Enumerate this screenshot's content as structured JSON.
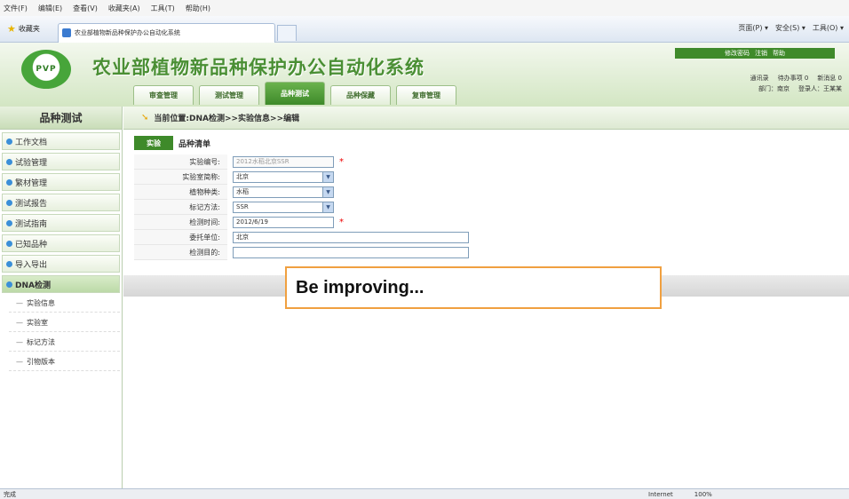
{
  "browser": {
    "menu": [
      "文件(F)",
      "编辑(E)",
      "查看(V)",
      "收藏夹(A)",
      "工具(T)",
      "帮助(H)"
    ],
    "favorites_label": "收藏夹",
    "tab_title": "农业部植物新品种保护办公自动化系统",
    "tools": [
      "页面(P) ▾",
      "安全(S) ▾",
      "工具(O) ▾"
    ],
    "status_left": "完成",
    "status_zone": "Internet",
    "status_zoom": "100%"
  },
  "app": {
    "logo_text": "PVP",
    "title": "农业部植物新品种保护办公自动化系统",
    "help_links": [
      "修改密码",
      "注销",
      "帮助"
    ],
    "user_row1": [
      "通讯录",
      "待办事项 0",
      "新消息 0"
    ],
    "user_row2": [
      "部门：南京",
      "登录人：王某某"
    ]
  },
  "nav": {
    "tabs": [
      {
        "label": "审查管理",
        "active": false
      },
      {
        "label": "测试管理",
        "active": false
      },
      {
        "label": "品种测试",
        "active": true
      },
      {
        "label": "品种保藏",
        "active": false
      },
      {
        "label": "复审管理",
        "active": false
      }
    ]
  },
  "sidebar": {
    "title": "品种测试",
    "items": [
      {
        "label": "工作文档"
      },
      {
        "label": "试验管理"
      },
      {
        "label": "繁材管理"
      },
      {
        "label": "测试报告"
      },
      {
        "label": "测试指南"
      },
      {
        "label": "已知品种"
      },
      {
        "label": "导入导出"
      },
      {
        "label": "DNA检测"
      }
    ],
    "sub_items": [
      "实验信息",
      "实验室",
      "标记方法",
      "引物版本"
    ]
  },
  "main": {
    "breadcrumb": "当前位置:DNA检测>>实验信息>>编辑",
    "tab_active": "实验",
    "tab_link": "品种清单",
    "form": [
      {
        "label": "实验编号:",
        "value": "2012水稻北京SSR",
        "type": "disabled",
        "required": true
      },
      {
        "label": "实验室简称:",
        "value": "北京",
        "type": "select",
        "required": false
      },
      {
        "label": "植物种类:",
        "value": "水稻",
        "type": "select",
        "required": false
      },
      {
        "label": "标记方法:",
        "value": "SSR",
        "type": "select",
        "required": false
      },
      {
        "label": "检测时间:",
        "value": "2012/6/19",
        "type": "input",
        "required": true
      },
      {
        "label": "委托单位:",
        "value": "北京",
        "type": "wide",
        "required": false
      },
      {
        "label": "检测目的:",
        "value": "",
        "type": "wide",
        "required": false
      }
    ],
    "required_mark": "*",
    "notice": "Be improving..."
  }
}
